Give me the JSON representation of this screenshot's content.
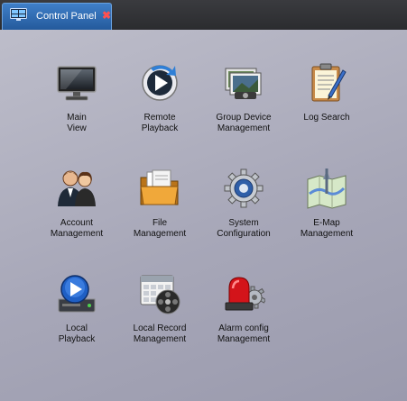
{
  "tab": {
    "title": "Control Panel",
    "close_glyph": "✖",
    "icon": "monitor-icon"
  },
  "items": [
    {
      "lines": [
        "Main",
        "View"
      ],
      "icon": "monitor-icon"
    },
    {
      "lines": [
        "Remote",
        "Playback"
      ],
      "icon": "remote-playback-icon"
    },
    {
      "lines": [
        "Group Device",
        "Management"
      ],
      "icon": "group-device-icon"
    },
    {
      "lines": [
        "Log Search"
      ],
      "icon": "log-search-icon"
    },
    {
      "lines": [
        "Account",
        "Management"
      ],
      "icon": "account-icon"
    },
    {
      "lines": [
        "File",
        "Management"
      ],
      "icon": "folder-icon"
    },
    {
      "lines": [
        "System",
        "Configuration"
      ],
      "icon": "gear-icon"
    },
    {
      "lines": [
        "E-Map",
        "Management"
      ],
      "icon": "map-icon"
    },
    {
      "lines": [
        "Local",
        "Playback"
      ],
      "icon": "local-playback-icon"
    },
    {
      "lines": [
        "Local Record",
        "Management"
      ],
      "icon": "calendar-film-icon"
    },
    {
      "lines": [
        "Alarm config",
        "Management"
      ],
      "icon": "alarm-icon"
    }
  ],
  "colors": {
    "tab_active": "#2f6db4",
    "background": "#aeaebf",
    "label_text": "#111111"
  }
}
